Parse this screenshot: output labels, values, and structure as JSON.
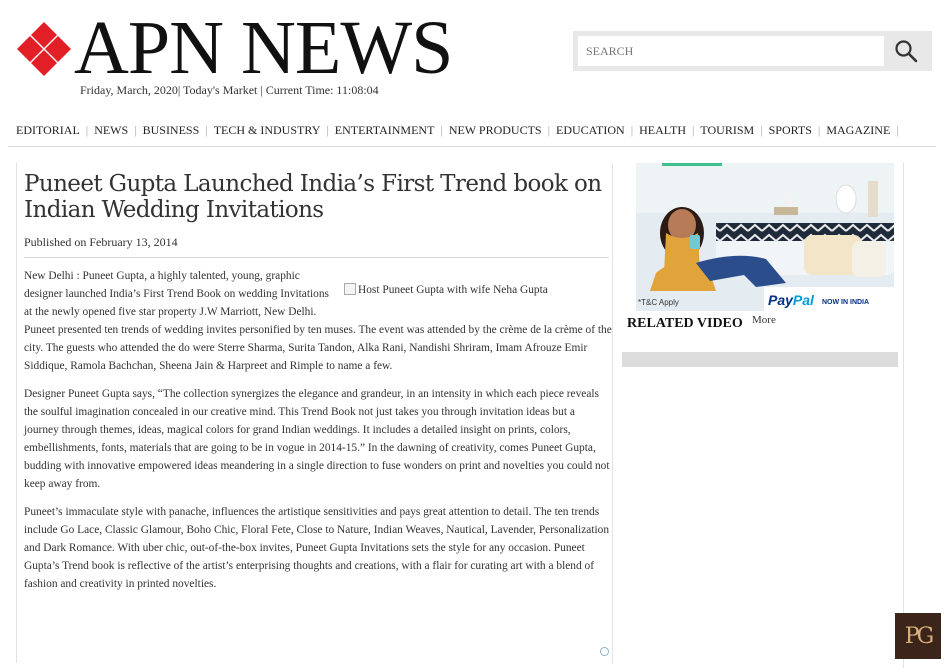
{
  "header": {
    "logo_text": "APN NEWS",
    "logo_icon": "red-diamond-logo-icon",
    "dateline": "Friday, March, 2020| Today's Market | Current Time: 11:08:04",
    "search": {
      "placeholder": "SEARCH",
      "icon": "search-icon"
    }
  },
  "nav": {
    "items": [
      {
        "label": "EDITORIAL"
      },
      {
        "label": "NEWS"
      },
      {
        "label": "BUSINESS"
      },
      {
        "label": "TECH & INDUSTRY"
      },
      {
        "label": "ENTERTAINMENT"
      },
      {
        "label": "NEW PRODUCTS"
      },
      {
        "label": "EDUCATION"
      },
      {
        "label": "HEALTH"
      },
      {
        "label": "TOURISM"
      },
      {
        "label": "SPORTS"
      },
      {
        "label": "MAGAZINE"
      }
    ]
  },
  "article": {
    "title": "Puneet Gupta Launched India’s First Trend book on Indian Wedding Invitations",
    "published": "Published on February 13, 2014",
    "image_alt": "Host Puneet Gupta with wife Neha Gupta",
    "paragraphs": [
      "New Delhi : Puneet Gupta, a highly talented, young, graphic designer launched India’s First Trend Book on wedding Invitations at the newly opened five star property J.W Marriott, New Delhi. Puneet presented ten trends of wedding invites personified by ten muses. The event was attended by the crème de la crème of the city. The guests who attended the do were Sterre Sharma, Surita Tandon, Alka Rani, Nandishi Shriram, Imam Afrouze Emir Siddique, Ramola Bachchan, Sheena Jain & Harpreet and Rimple to name a few.",
      "Designer Puneet Gupta says, “The collection synergizes the elegance and grandeur, in an intensity in which each piece reveals the soulful imagination concealed in our creative mind. This Trend Book not just takes you through invitation ideas but a journey through themes, ideas, magical colors for grand Indian weddings. It includes a detailed insight on prints, colors, embellishments, fonts, materials that are going to be in vogue in 2014-15.”  In the dawning of creativity, comes Puneet Gupta, budding with innovative empowered ideas meandering in a single direction to fuse wonders on print and novelties you could not keep away from.",
      "Puneet’s immaculate style with panache, influences the artistique sensitivities and pays great attention to detail. The ten trends include Go Lace, Classic Glamour, Boho Chic, Floral Fete, Close to Nature, Indian Weaves, Nautical, Lavender, Personalization and Dark Romance. With uber chic, out-of-the-box invites, Puneet Gupta Invitations sets the style for any occasion. Puneet Gupta’s Trend book is reflective of the artist’s enterprising thoughts and creations, with a flair for curating art with a blend of fashion and creativity in printed novelties."
    ]
  },
  "sidebar": {
    "ad": {
      "brand": "PayPal",
      "tagline": "NOW IN INDIA",
      "fineprint": "*T&C Apply"
    },
    "related_title": "RELATED VIDEO",
    "more_label": "More"
  },
  "badge": {
    "text": "PG"
  },
  "colors": {
    "logo_red": "#e21e26",
    "nav_rule": "#dcdcdc",
    "paypal_dark": "#003087",
    "paypal_light": "#009cde",
    "badge_bg": "#3b241a"
  }
}
